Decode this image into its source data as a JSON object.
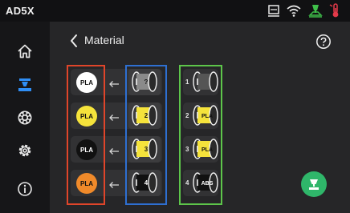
{
  "app": {
    "brand": "AD5X"
  },
  "status_bar": {
    "icons": [
      "printer-status-icon",
      "wifi-icon",
      "printing-status-icon",
      "temperature-alert-icon"
    ]
  },
  "sidebar": {
    "items": [
      {
        "name": "home",
        "icon": "home-icon",
        "active": false
      },
      {
        "name": "material",
        "icon": "material-icon",
        "active": true
      },
      {
        "name": "filament",
        "icon": "filament-reel-icon",
        "active": false
      },
      {
        "name": "settings",
        "icon": "gear-icon",
        "active": false
      },
      {
        "name": "info",
        "icon": "info-icon",
        "active": false
      }
    ]
  },
  "header": {
    "title": "Material"
  },
  "mapping": [
    {
      "material": "PLA",
      "color": "#ffffff",
      "arrow": "←",
      "spool_label": "?",
      "spool_color": "#8a8a8a"
    },
    {
      "material": "PLA",
      "color": "#f5e33b",
      "arrow": "←",
      "spool_label": "2",
      "spool_color": "#f5e33b"
    },
    {
      "material": "PLA",
      "color": "#111111",
      "arrow": "←",
      "spool_label": "3",
      "spool_color": "#f5e33b"
    },
    {
      "material": "PLA",
      "color": "#f08a2a",
      "arrow": "←",
      "spool_label": "4",
      "spool_color": "#111111"
    }
  ],
  "slots": [
    {
      "number": "1",
      "material": "",
      "color": "#555555"
    },
    {
      "number": "2",
      "material": "PLA",
      "color": "#f5e33b"
    },
    {
      "number": "3",
      "material": "PLA",
      "color": "#f5e33b"
    },
    {
      "number": "4",
      "material": "ABS",
      "color": "#111111"
    }
  ],
  "colors": {
    "accent_blue": "#2f8ef5",
    "frame_red": "#e0452a",
    "frame_blue": "#2e6fd1",
    "frame_green": "#5dc54a",
    "fab_green": "#2fb66a"
  }
}
